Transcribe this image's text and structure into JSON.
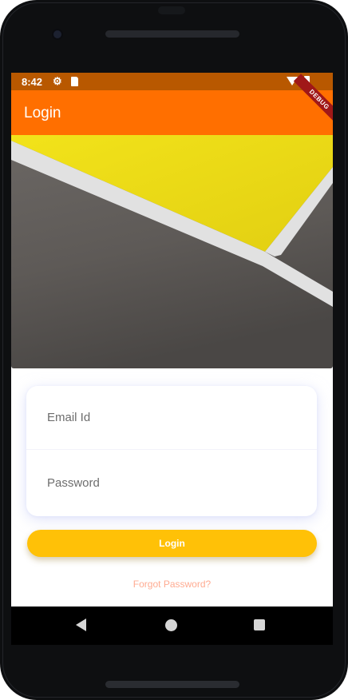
{
  "status_bar": {
    "time": "8:42",
    "icons": [
      "gear-icon",
      "sd-card-icon",
      "wifi-icon",
      "battery-icon"
    ]
  },
  "app_bar": {
    "title": "Login",
    "debug_banner": "DEBUG",
    "color": "#ff6f00"
  },
  "hero": {
    "description_colors": {
      "yellow": "#eadc17",
      "stripe": "#e3e3e3",
      "ground": "#625e5b"
    }
  },
  "form": {
    "email_placeholder": "Email Id",
    "email_value": "",
    "password_placeholder": "Password",
    "password_value": ""
  },
  "login_button": {
    "label": "Login",
    "color": "#ffc107"
  },
  "forgot_password": {
    "label": "Forgot Password?",
    "color": "#ffab91"
  },
  "nav_bar": {
    "icons": [
      "back-icon",
      "home-icon",
      "recents-icon"
    ]
  }
}
